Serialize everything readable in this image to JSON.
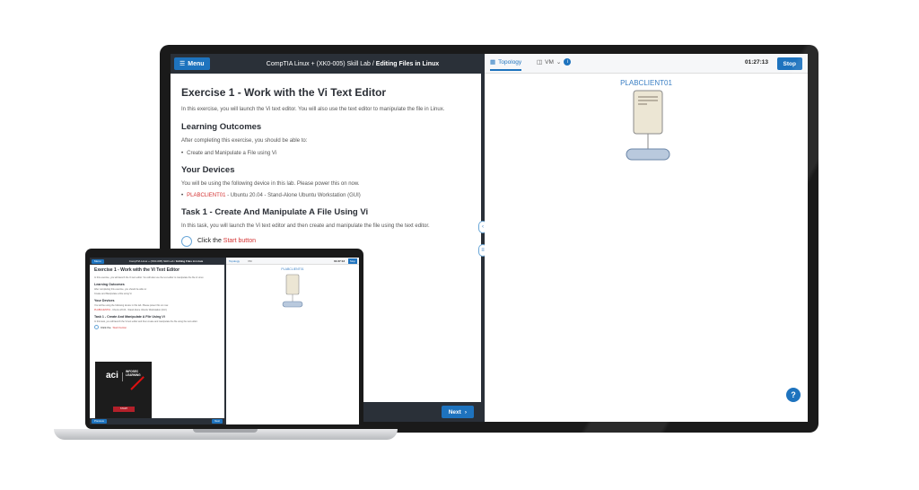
{
  "lab": {
    "menu_label": "Menu",
    "course": "CompTIA Linux + (XK0-005) Skill Lab",
    "separator": "/",
    "title": "Editing Files in Linux"
  },
  "content": {
    "exercise_title": "Exercise 1 - Work with the Vi Text Editor",
    "intro": "In this exercise, you will launch the Vi text editor. You will also use the text editor to manipulate the file in Linux.",
    "outcomes_heading": "Learning Outcomes",
    "outcomes_intro": "After completing this exercise, you should be able to:",
    "outcomes": [
      "Create and Manipulate a File using Vi"
    ],
    "devices_heading": "Your Devices",
    "devices_intro": "You will be using the following device in this lab. Please power this on now.",
    "device_name": "PLABCLIENT01",
    "device_desc": " - Ubuntu 20.04 - Stand-Alone Ubuntu Workstation (GUI)",
    "task_heading": "Task 1 - Create And Manipulate A File Using Vi",
    "task_intro": "In this task, you will launch the Vi text editor and then create and manipulate the file using the text editor.",
    "step_prefix": "Click the ",
    "step_link": "Start button"
  },
  "footer": {
    "next_label": "Next",
    "previous_label": "Previous"
  },
  "topology": {
    "tab_topology": "Topology",
    "tab_vm": "VM",
    "timer": "01:27:13",
    "stop_label": "Stop",
    "device_label": "PLABCLIENT01",
    "help_label": "?"
  },
  "video": {
    "logo": "aci",
    "brand_line1": "INFOSEC",
    "brand_line2": "LEARNING",
    "start_label": "START"
  },
  "colors": {
    "accent": "#1e73be",
    "header_dark": "#2a3038",
    "link_red": "#d43333",
    "device_blue": "#3b7fc4"
  }
}
